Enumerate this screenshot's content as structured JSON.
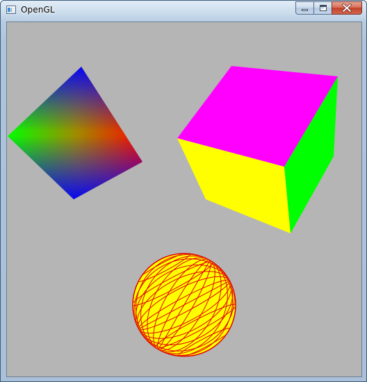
{
  "window": {
    "title": "OpenGL",
    "app_icon": "window-app-icon"
  },
  "caption_buttons": {
    "minimize_icon": "minimize-icon",
    "maximize_icon": "maximize-icon",
    "close_icon": "close-icon"
  },
  "scene": {
    "background_color": "#b5b5b5",
    "objects": [
      {
        "name": "gradient-square",
        "colors": [
          "#00ff00",
          "#0000ff",
          "#ff0000"
        ]
      },
      {
        "name": "cube",
        "colors": {
          "top": "#ff00ff",
          "front": "#ffff00",
          "side": "#00ff00"
        }
      },
      {
        "name": "wireframe-sphere",
        "fill": "#ffff00",
        "grid": "#ff0000"
      }
    ]
  }
}
